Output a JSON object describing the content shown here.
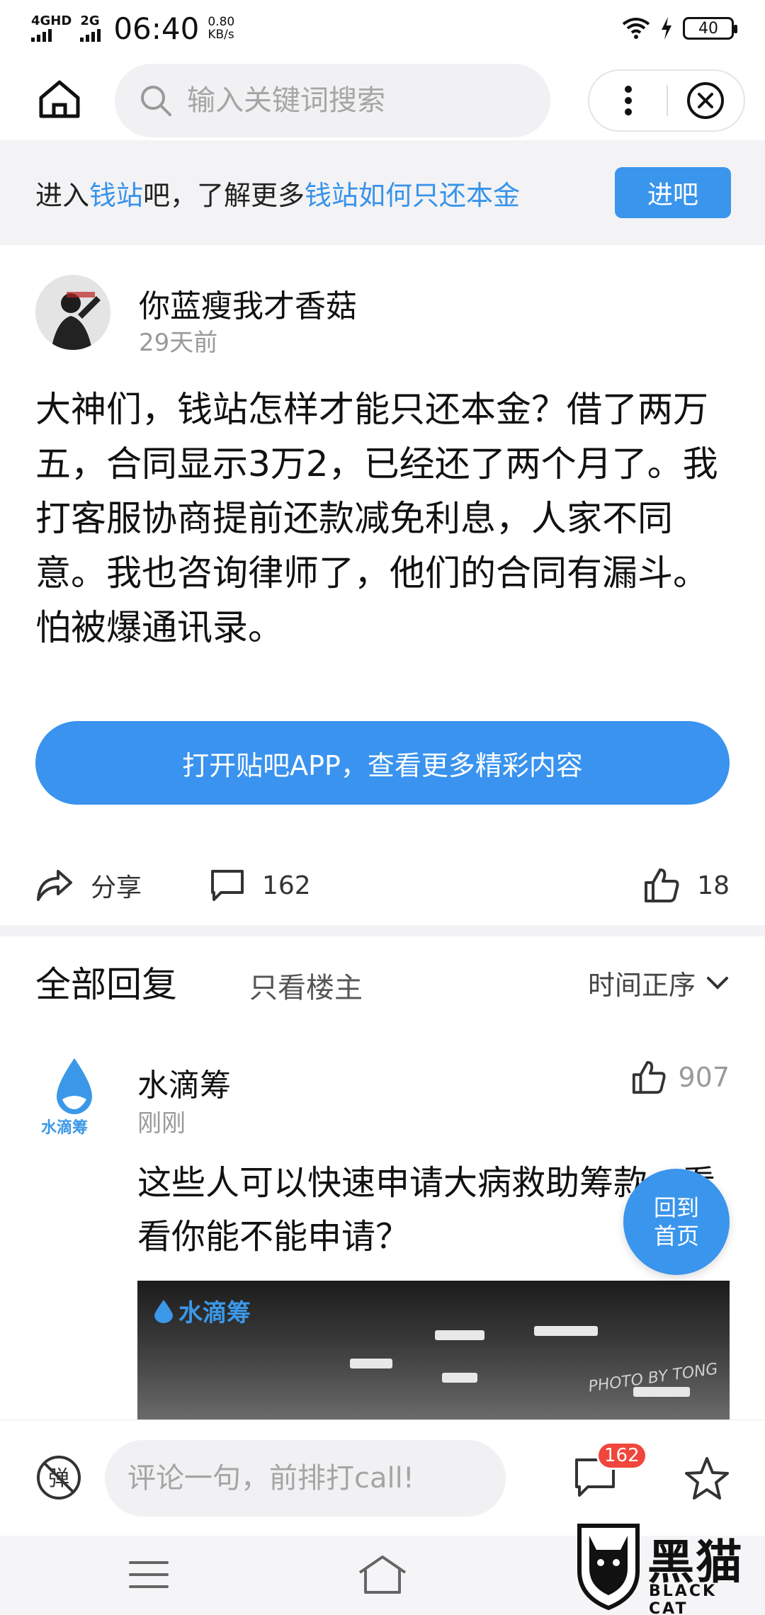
{
  "status_bar": {
    "network_1": "4GHD",
    "network_2": "2G",
    "time": "06:40",
    "speed_value": "0.80",
    "speed_unit": "KB/s",
    "battery": "40"
  },
  "top_nav": {
    "search_placeholder": "输入关键词搜索"
  },
  "banner": {
    "part1": "进入",
    "link1": "钱站",
    "part2": "吧，了解更多",
    "link2": "钱站如何只还本金",
    "button": "进吧"
  },
  "post": {
    "author": "你蓝瘦我才香菇",
    "time": "29天前",
    "body": "大神们，钱站怎样才能只还本金？借了两万五，合同显示3万2，已经还了两个月了。我打客服协商提前还款减免利息，人家不同意。我也咨询律师了，他们的合同有漏斗。怕被爆通讯录。",
    "open_app": "打开贴吧APP，查看更多精彩内容",
    "share_label": "分享",
    "comment_count": "162",
    "like_count": "18"
  },
  "replies": {
    "title": "全部回复",
    "only_op": "只看楼主",
    "sort": "时间正序"
  },
  "reply": {
    "avatar_text": "水滴筹",
    "name": "水滴筹",
    "time": "刚刚",
    "like_count": "907",
    "body": "这些人可以快速申请大病救助筹款，看看你能不能申请？",
    "image_watermark": "水滴筹",
    "image_credit": "PHOTO BY TONG"
  },
  "back_home": {
    "line1": "回到",
    "line2": "首页"
  },
  "comment_bar": {
    "placeholder": "评论一句，前排打call!",
    "badge": "162"
  },
  "watermark": {
    "title": "黑猫",
    "subtitle": "BLACK CAT"
  },
  "colors": {
    "accent": "#3a95ec",
    "badge": "#f0463c",
    "muted": "#9a9a9a"
  }
}
